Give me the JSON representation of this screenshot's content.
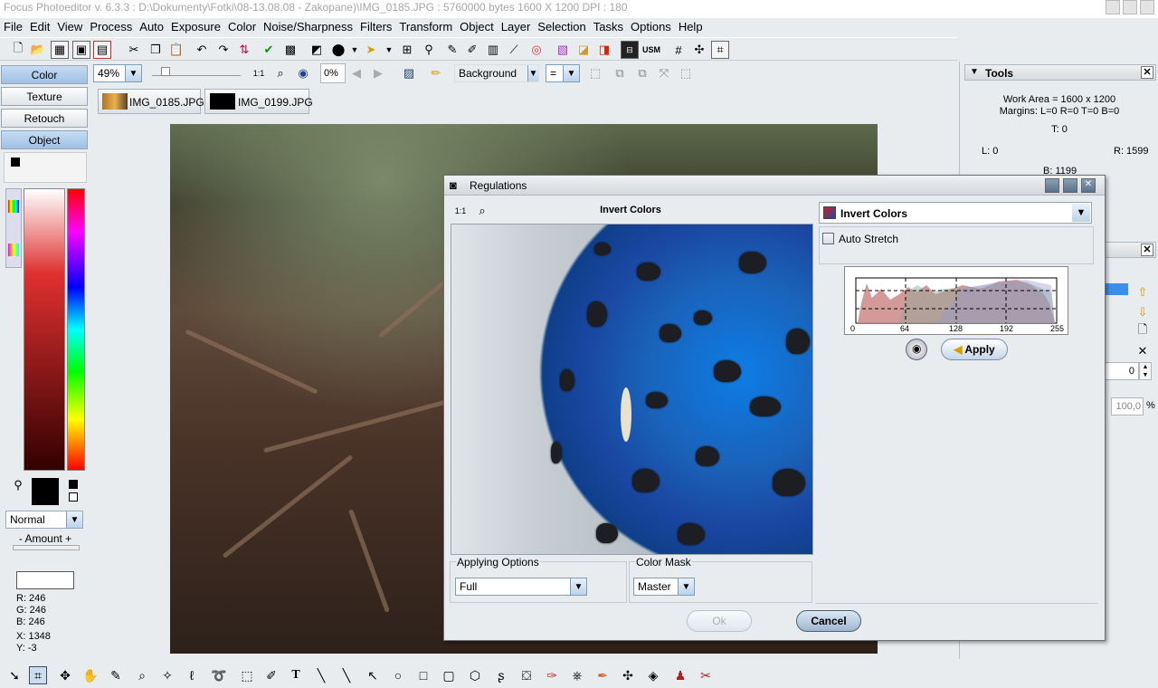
{
  "window": {
    "title": "Focus Photoeditor v. 6.3.3 :  D:\\Dokumenty\\Fotki\\08-13.08.08 - Zakopane)\\IMG_0185.JPG : 5760000 bytes    1600 X 1200 DPI : 180"
  },
  "menu": [
    "File",
    "Edit",
    "View",
    "Process",
    "Auto",
    "Exposure",
    "Color",
    "Noise/Sharpness",
    "Filters",
    "Transform",
    "Object",
    "Layer",
    "Selection",
    "Tasks",
    "Options",
    "Help"
  ],
  "optionbar": {
    "zoom": "49%",
    "percent": "0%",
    "layer": "Background",
    "blend": "="
  },
  "leftpanel": {
    "tabs": [
      "Color",
      "Texture",
      "Retouch",
      "Object"
    ],
    "mode": "Normal",
    "amount_label": "- Amount +",
    "readout": {
      "r": "R: 246",
      "g": "G: 246",
      "b": "B: 246",
      "x": "X: 1348",
      "y": "Y: -3"
    }
  },
  "doc_tabs": [
    "IMG_0185.JPG",
    "IMG_0199.JPG"
  ],
  "tools_panel": {
    "title": "Tools",
    "work_area": "Work Area = 1600 x 1200",
    "margins": "Margins: L=0 R=0 T=0 B=0",
    "t": "T: 0",
    "l": "L: 0",
    "r": "R: 1599",
    "b": "B: 1199",
    "field_value": "0",
    "percent_value": "100,0",
    "percent_unit": "%"
  },
  "dialog": {
    "title": "Regulations",
    "preview_title": "Invert Colors",
    "effect": "Invert Colors",
    "auto_stretch": "Auto Stretch",
    "histogram_ticks": [
      "0",
      "64",
      "128",
      "192",
      "255"
    ],
    "apply": "Apply",
    "applying_options_label": "Applying Options",
    "applying_options_value": "Full",
    "color_mask_label": "Color Mask",
    "color_mask_value": "Master",
    "ok": "Ok",
    "cancel": "Cancel"
  },
  "colors": {
    "accent": "#9fc0e4",
    "dialog_bg": "#e9ecef",
    "preview_blue": "#1a62b9"
  }
}
